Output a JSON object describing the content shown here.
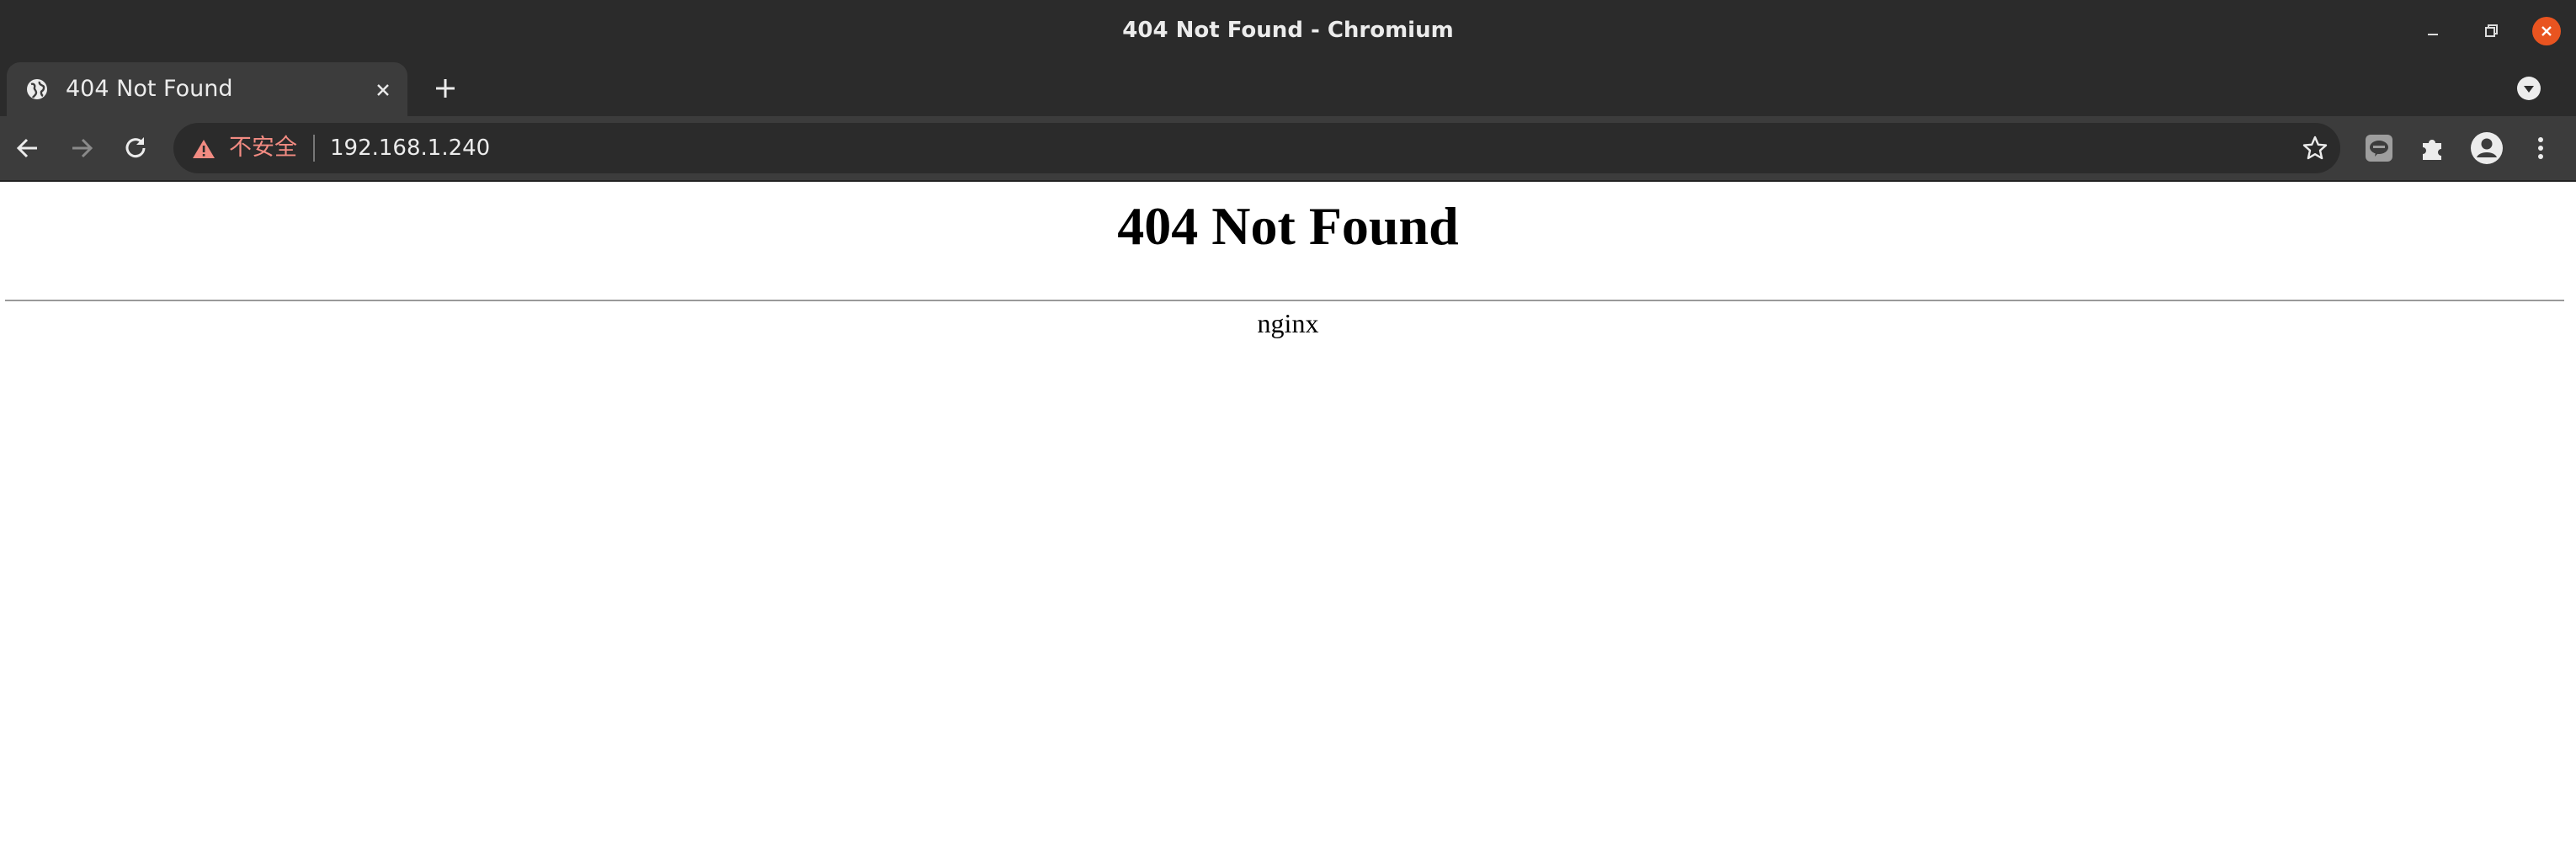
{
  "window": {
    "title": "404 Not Found - Chromium",
    "controls": [
      "minimize-icon",
      "restore-icon",
      "close-icon"
    ],
    "close_color": "#e95420"
  },
  "tabs": [
    {
      "title": "404 Not Found",
      "favicon": "globe-icon",
      "active": true
    }
  ],
  "toolbar": {
    "security_label": "不安全",
    "security_color": "#f28b82",
    "url": "192.168.1.240",
    "icons": [
      "back-icon",
      "forward-icon",
      "reload-icon",
      "warning-icon",
      "star-icon",
      "line-extension-icon",
      "puzzle-icon",
      "profile-icon",
      "menu-icon"
    ]
  },
  "page": {
    "heading": "404 Not Found",
    "server": "nginx"
  }
}
